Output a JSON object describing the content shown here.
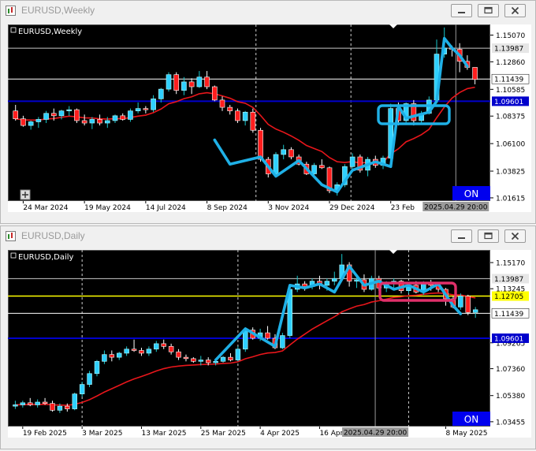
{
  "windows": [
    {
      "id": "weekly",
      "window_title": "EURUSD,Weekly",
      "chart_label": "EURUSD,Weekly",
      "on_label": "ON",
      "price_ticks": [
        "1.15070",
        "1.12860",
        "1.10585",
        "1.08375",
        "1.06100",
        "1.03825",
        "1.01615"
      ],
      "price_ticks_hidden": [
        "1.13987",
        "1.11439",
        "1.09601"
      ],
      "date_ticks": [
        "24 Mar 2024",
        "19 May 2024",
        "14 Jul 2024",
        "8 Sep 2024",
        "3 Nov 2024",
        "29 Dec 2024",
        "23 Feb"
      ],
      "crosshair_label": "2025.04.29 20:00"
    },
    {
      "id": "daily",
      "window_title": "EURUSD,Daily",
      "chart_label": "EURUSD,Daily",
      "on_label": "ON",
      "price_ticks": [
        "1.15170",
        "1.13245",
        "1.09265",
        "1.07360",
        "1.05380",
        "1.03455"
      ],
      "price_ticks_hidden": [
        "1.13987",
        "1.12705",
        "1.11439",
        "1.09601"
      ],
      "date_ticks": [
        "19 Feb 2025",
        "3 Mar 2025",
        "13 Mar 2025",
        "25 Mar 2025",
        "4 Apr 2025",
        "16 Apr",
        "8 May 2025"
      ],
      "crosshair_label": "2025.04.29 20:00"
    }
  ],
  "chart_data": [
    {
      "type": "candlestick",
      "symbol": "EURUSD",
      "timeframe": "Weekly",
      "ylim": [
        1.0135,
        1.1595
      ],
      "y_ticks": [
        1.1507,
        1.1286,
        1.10585,
        1.08375,
        1.061,
        1.03825,
        1.01615
      ],
      "horizontal_lines": [
        {
          "price": 1.13987,
          "color": "#c8c8c8",
          "label": "1.13987"
        },
        {
          "price": 1.11439,
          "color": "#ffffff",
          "label": "1.11439"
        },
        {
          "price": 1.09601,
          "color": "#0000cc",
          "label": "1.09601"
        }
      ],
      "moving_average_color": "#e8161b",
      "trend_sketch_color": "#1fb0e6",
      "highlight_box_color": "#1fb0e6",
      "ohlc": [
        [
          1.088,
          1.093,
          1.08,
          1.0815
        ],
        [
          1.0815,
          1.084,
          1.075,
          1.076
        ],
        [
          1.076,
          1.08,
          1.0725,
          1.079
        ],
        [
          1.079,
          1.083,
          1.074,
          1.081
        ],
        [
          1.081,
          1.088,
          1.078,
          1.086
        ],
        [
          1.086,
          1.09,
          1.08,
          1.084
        ],
        [
          1.084,
          1.089,
          1.081,
          1.088
        ],
        [
          1.088,
          1.092,
          1.084,
          1.089
        ],
        [
          1.089,
          1.09,
          1.078,
          1.08
        ],
        [
          1.08,
          1.085,
          1.076,
          1.078
        ],
        [
          1.078,
          1.083,
          1.073,
          1.081
        ],
        [
          1.081,
          1.085,
          1.076,
          1.078
        ],
        [
          1.078,
          1.083,
          1.074,
          1.08
        ],
        [
          1.08,
          1.085,
          1.078,
          1.084
        ],
        [
          1.084,
          1.086,
          1.08,
          1.081
        ],
        [
          1.081,
          1.09,
          1.079,
          1.088
        ],
        [
          1.088,
          1.095,
          1.086,
          1.09
        ],
        [
          1.09,
          1.092,
          1.086,
          1.089
        ],
        [
          1.089,
          1.101,
          1.087,
          1.098
        ],
        [
          1.098,
          1.107,
          1.095,
          1.106
        ],
        [
          1.106,
          1.12,
          1.104,
          1.118
        ],
        [
          1.118,
          1.12,
          1.102,
          1.105
        ],
        [
          1.105,
          1.116,
          1.101,
          1.112
        ],
        [
          1.112,
          1.115,
          1.102,
          1.108
        ],
        [
          1.108,
          1.121,
          1.107,
          1.116
        ],
        [
          1.116,
          1.121,
          1.106,
          1.108
        ],
        [
          1.108,
          1.109,
          1.096,
          1.097
        ],
        [
          1.097,
          1.1,
          1.088,
          1.091
        ],
        [
          1.091,
          1.093,
          1.085,
          1.088
        ],
        [
          1.088,
          1.09,
          1.078,
          1.08
        ],
        [
          1.08,
          1.088,
          1.076,
          1.087
        ],
        [
          1.087,
          1.09,
          1.07,
          1.072
        ],
        [
          1.072,
          1.074,
          1.046,
          1.048
        ],
        [
          1.048,
          1.05,
          1.033,
          1.036
        ],
        [
          1.036,
          1.054,
          1.034,
          1.052
        ],
        [
          1.052,
          1.06,
          1.048,
          1.056
        ],
        [
          1.056,
          1.058,
          1.048,
          1.05
        ],
        [
          1.05,
          1.052,
          1.043,
          1.044
        ],
        [
          1.044,
          1.046,
          1.035,
          1.036
        ],
        [
          1.036,
          1.045,
          1.033,
          1.043
        ],
        [
          1.043,
          1.048,
          1.04,
          1.041
        ],
        [
          1.041,
          1.042,
          1.02,
          1.022
        ],
        [
          1.022,
          1.029,
          1.018,
          1.027
        ],
        [
          1.027,
          1.044,
          1.025,
          1.042
        ],
        [
          1.042,
          1.053,
          1.038,
          1.05
        ],
        [
          1.05,
          1.052,
          1.037,
          1.039
        ],
        [
          1.039,
          1.05,
          1.034,
          1.048
        ],
        [
          1.048,
          1.051,
          1.041,
          1.043
        ],
        [
          1.043,
          1.051,
          1.04,
          1.049
        ],
        [
          1.049,
          1.094,
          1.048,
          1.09
        ],
        [
          1.09,
          1.095,
          1.076,
          1.08
        ],
        [
          1.08,
          1.095,
          1.078,
          1.094
        ],
        [
          1.094,
          1.097,
          1.076,
          1.08
        ],
        [
          1.08,
          1.088,
          1.077,
          1.086
        ],
        [
          1.086,
          1.1,
          1.085,
          1.097
        ],
        [
          1.097,
          1.147,
          1.095,
          1.135
        ],
        [
          1.135,
          1.157,
          1.132,
          1.14
        ],
        [
          1.14,
          1.142,
          1.133,
          1.139
        ],
        [
          1.139,
          1.144,
          1.12,
          1.129
        ],
        [
          1.129,
          1.134,
          1.122,
          1.124
        ],
        [
          1.124,
          1.124,
          1.11,
          1.114
        ]
      ],
      "x_labels": [
        {
          "text": "24 Mar 2024",
          "at": 1
        },
        {
          "text": "19 May 2024",
          "at": 9
        },
        {
          "text": "14 Jul 2024",
          "at": 17
        },
        {
          "text": "8 Sep 2024",
          "at": 25
        },
        {
          "text": "3 Nov 2024",
          "at": 33
        },
        {
          "text": "29 Dec 2024",
          "at": 41
        },
        {
          "text": "23 Feb",
          "at": 49
        }
      ],
      "crosshair_at": 57.5
    },
    {
      "type": "candlestick",
      "symbol": "EURUSD",
      "timeframe": "Daily",
      "ylim": [
        1.031,
        1.161
      ],
      "y_ticks": [
        1.1517,
        1.13245,
        1.09265,
        1.0736,
        1.0538,
        1.03455
      ],
      "horizontal_lines": [
        {
          "price": 1.13987,
          "color": "#c8c8c8",
          "label": "1.13987"
        },
        {
          "price": 1.12705,
          "color": "#ffff00",
          "label": "1.12705"
        },
        {
          "price": 1.11439,
          "color": "#ffffff",
          "label": "1.11439"
        },
        {
          "price": 1.09601,
          "color": "#0000cc",
          "label": "1.09601"
        }
      ],
      "moving_average_color": "#e8161b",
      "trend_sketch_color": "#1fb0e6",
      "highlight_box_color": "#e0306a",
      "ohlc": [
        [
          1.046,
          1.05,
          1.044,
          1.047
        ],
        [
          1.047,
          1.05,
          1.045,
          1.0485
        ],
        [
          1.0485,
          1.052,
          1.046,
          1.047
        ],
        [
          1.047,
          1.051,
          1.045,
          1.049
        ],
        [
          1.049,
          1.052,
          1.047,
          1.048
        ],
        [
          1.048,
          1.05,
          1.042,
          1.043
        ],
        [
          1.043,
          1.048,
          1.041,
          1.046
        ],
        [
          1.046,
          1.048,
          1.042,
          1.044
        ],
        [
          1.044,
          1.056,
          1.043,
          1.055
        ],
        [
          1.055,
          1.064,
          1.053,
          1.062
        ],
        [
          1.062,
          1.072,
          1.06,
          1.07
        ],
        [
          1.07,
          1.08,
          1.068,
          1.079
        ],
        [
          1.079,
          1.087,
          1.077,
          1.084
        ],
        [
          1.084,
          1.087,
          1.079,
          1.082
        ],
        [
          1.082,
          1.086,
          1.08,
          1.085
        ],
        [
          1.085,
          1.09,
          1.083,
          1.088
        ],
        [
          1.088,
          1.095,
          1.086,
          1.087
        ],
        [
          1.087,
          1.089,
          1.083,
          1.085
        ],
        [
          1.085,
          1.09,
          1.083,
          1.088
        ],
        [
          1.088,
          1.094,
          1.086,
          1.092
        ],
        [
          1.092,
          1.095,
          1.088,
          1.09
        ],
        [
          1.09,
          1.092,
          1.084,
          1.086
        ],
        [
          1.086,
          1.088,
          1.08,
          1.082
        ],
        [
          1.082,
          1.084,
          1.079,
          1.081
        ],
        [
          1.081,
          1.082,
          1.078,
          1.079
        ],
        [
          1.079,
          1.083,
          1.076,
          1.08
        ],
        [
          1.08,
          1.082,
          1.076,
          1.078
        ],
        [
          1.078,
          1.08,
          1.076,
          1.079
        ],
        [
          1.079,
          1.083,
          1.078,
          1.082
        ],
        [
          1.082,
          1.085,
          1.079,
          1.08
        ],
        [
          1.08,
          1.09,
          1.079,
          1.088
        ],
        [
          1.088,
          1.104,
          1.086,
          1.102
        ],
        [
          1.102,
          1.104,
          1.095,
          1.096
        ],
        [
          1.096,
          1.103,
          1.094,
          1.1
        ],
        [
          1.1,
          1.105,
          1.095,
          1.096
        ],
        [
          1.096,
          1.099,
          1.088,
          1.089
        ],
        [
          1.089,
          1.1,
          1.088,
          1.098
        ],
        [
          1.098,
          1.136,
          1.096,
          1.132
        ],
        [
          1.132,
          1.142,
          1.13,
          1.136
        ],
        [
          1.136,
          1.138,
          1.131,
          1.134
        ],
        [
          1.134,
          1.14,
          1.132,
          1.138
        ],
        [
          1.138,
          1.142,
          1.132,
          1.135
        ],
        [
          1.135,
          1.14,
          1.131,
          1.138
        ],
        [
          1.138,
          1.145,
          1.135,
          1.14
        ],
        [
          1.14,
          1.158,
          1.138,
          1.15
        ],
        [
          1.15,
          1.152,
          1.134,
          1.138
        ],
        [
          1.138,
          1.142,
          1.133,
          1.139
        ],
        [
          1.139,
          1.143,
          1.13,
          1.132
        ],
        [
          1.132,
          1.142,
          1.131,
          1.14
        ],
        [
          1.14,
          1.142,
          1.131,
          1.133
        ],
        [
          1.133,
          1.138,
          1.13,
          1.136
        ],
        [
          1.136,
          1.14,
          1.133,
          1.138
        ],
        [
          1.138,
          1.139,
          1.129,
          1.131
        ],
        [
          1.131,
          1.136,
          1.129,
          1.135
        ],
        [
          1.135,
          1.138,
          1.129,
          1.13
        ],
        [
          1.13,
          1.138,
          1.128,
          1.136
        ],
        [
          1.136,
          1.139,
          1.131,
          1.135
        ],
        [
          1.135,
          1.137,
          1.13,
          1.132
        ],
        [
          1.132,
          1.133,
          1.12,
          1.125
        ],
        [
          1.125,
          1.127,
          1.118,
          1.119
        ],
        [
          1.119,
          1.129,
          1.117,
          1.127
        ],
        [
          1.127,
          1.128,
          1.113,
          1.115
        ],
        [
          1.115,
          1.119,
          1.111,
          1.117
        ]
      ],
      "x_labels": [
        {
          "text": "19 Feb 2025",
          "at": 1
        },
        {
          "text": "3 Mar 2025",
          "at": 9
        },
        {
          "text": "13 Mar 2025",
          "at": 17
        },
        {
          "text": "25 Mar 2025",
          "at": 25
        },
        {
          "text": "4 Apr 2025",
          "at": 33
        },
        {
          "text": "16 Apr",
          "at": 41
        },
        {
          "text": "8 May 2025",
          "at": 58
        }
      ],
      "crosshair_at": 48.5
    }
  ]
}
